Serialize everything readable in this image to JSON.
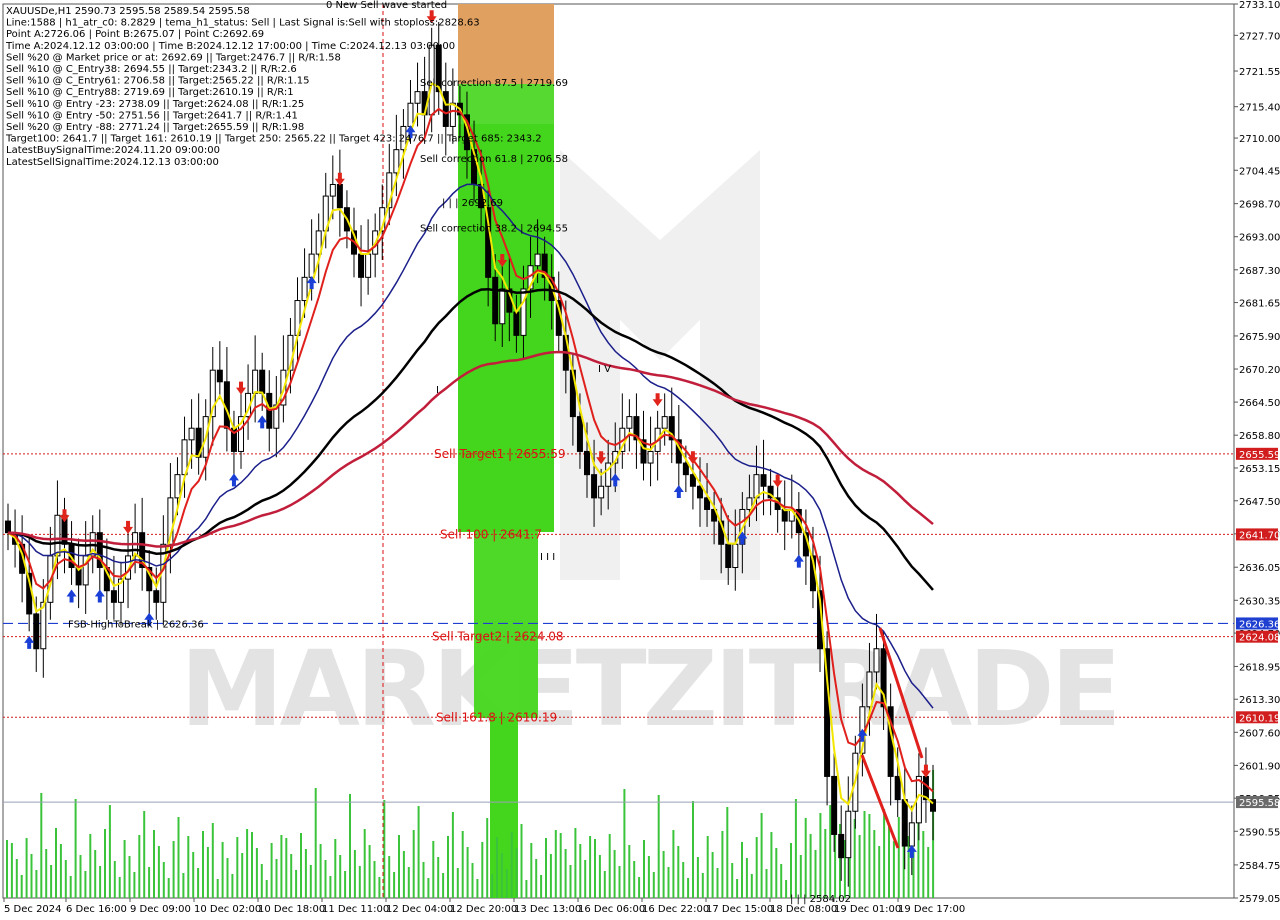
{
  "header": {
    "info_lines": [
      "XAUUSDe,H1  2590.73 2595.58 2589.54 2595.58",
      "Line:1588  |  h1_atr_c0: 8.2829  |  tema_h1_status: Sell  |  Last Signal is:Sell with stoploss:2828.63",
      "Point A:2726.06  |  Point B:2675.07  |  Point C:2692.69",
      "Time A:2024.12.12 03:00:00  |  Time B:2024.12.12 17:00:00  |  Time C:2024.12.13 03:00:00",
      "Sell %20 @ Market price or at: 2692.69  ||  Target:2476.7  ||  R/R:1.58",
      "Sell %10 @ C_Entry38: 2694.55  ||  Target:2343.2  ||  R/R:2.6",
      "Sell %10 @ C_Entry61: 2706.58  ||  Target:2565.22  ||  R/R:1.15",
      "Sell %10 @ C_Entry88: 2719.69  ||  Target:2610.19  ||  R/R:1",
      "Sell %10 @ Entry -23: 2738.09  ||  Target:2624.08  ||  R/R:1.25",
      "Sell %10 @ Entry -50: 2751.56  ||  Target:2641.7  ||  R/R:1.41",
      "Sell %20 @ Entry -88: 2771.24  ||  Target:2655.59  ||  R/R:1.98",
      "Target100: 2641.7  ||  Target 161: 2610.19  ||  Target 250: 2565.22  ||  Target 423: 2476.7  ||  Target 685: 2343.2",
      "LatestBuySignalTime:2024.11.20 09:00:00",
      "LatestSellSignalTime:2024.12.13 03:00:00"
    ],
    "wave_label": "0 New Sell wave started"
  },
  "watermark": "MARKETZITRADE",
  "chart_data": {
    "type": "candlestick",
    "symbol": "XAUUSDe",
    "timeframe": "H1",
    "ylim": [
      2579.05,
      2733.1
    ],
    "y_ticks": [
      2733.1,
      2727.7,
      2721.55,
      2715.4,
      2710.0,
      2704.45,
      2698.7,
      2693.0,
      2687.3,
      2681.65,
      2675.9,
      2670.2,
      2664.5,
      2658.8,
      2653.15,
      2647.5,
      2641.8,
      2636.05,
      2630.35,
      2624.7,
      2618.95,
      2613.3,
      2607.6,
      2601.9,
      2596.25,
      2590.55,
      2584.75,
      2579.05
    ],
    "y_tick_labels": [
      "2733.10",
      "2727.70",
      "2721.55",
      "2715.40",
      "2710.00",
      "2704.45",
      "2698.70",
      "2693.00",
      "2687.30",
      "2681.65",
      "2675.90",
      "2670.20",
      "2664.50",
      "2658.80",
      "2653.15",
      "2647.50",
      "2641.80",
      "2636.05",
      "2630.35",
      "2624.70",
      "2618.95",
      "2613.30",
      "2607.60",
      "2601.90",
      "2596.25",
      "2590.55",
      "2584.75",
      "2579.05"
    ],
    "x_tick_labels": [
      "5 Dec 2024",
      "6 Dec 16:00",
      "9 Dec 09:00",
      "10 Dec 02:00",
      "10 Dec 18:00",
      "11 Dec 11:00",
      "12 Dec 04:00",
      "12 Dec 20:00",
      "13 Dec 13:00",
      "16 Dec 06:00",
      "16 Dec 22:00",
      "17 Dec 15:00",
      "18 Dec 08:00",
      "19 Dec 01:00",
      "19 Dec 17:00"
    ],
    "closes": [
      2642,
      2640,
      2635,
      2628,
      2622,
      2630,
      2638,
      2645,
      2640,
      2636,
      2633,
      2638,
      2642,
      2636,
      2632,
      2630,
      2634,
      2638,
      2642,
      2636,
      2632,
      2630,
      2640,
      2648,
      2652,
      2658,
      2660,
      2655,
      2662,
      2670,
      2668,
      2660,
      2656,
      2662,
      2666,
      2670,
      2666,
      2660,
      2664,
      2670,
      2676,
      2682,
      2686,
      2690,
      2694,
      2700,
      2702,
      2698,
      2694,
      2690,
      2686,
      2690,
      2694,
      2698,
      2704,
      2708,
      2712,
      2716,
      2718,
      2714,
      2726,
      2718,
      2712,
      2716,
      2714,
      2708,
      2702,
      2698,
      2686,
      2678,
      2684,
      2680,
      2676,
      2684,
      2688,
      2690,
      2686,
      2682,
      2676,
      2670,
      2662,
      2656,
      2652,
      2648,
      2650,
      2654,
      2656,
      2660,
      2662,
      2658,
      2654,
      2656,
      2660,
      2662,
      2658,
      2654,
      2652,
      2650,
      2648,
      2646,
      2644,
      2640,
      2636,
      2640,
      2646,
      2648,
      2652,
      2650,
      2648,
      2646,
      2644,
      2646,
      2642,
      2638,
      2632,
      2622,
      2600,
      2590,
      2586,
      2594,
      2604,
      2612,
      2618,
      2622,
      2612,
      2600,
      2596,
      2588,
      2592,
      2600,
      2596,
      2594
    ],
    "current_price": 2595.58,
    "levels": [
      {
        "label": "Sell correction 87.5 | 2719.69",
        "price": 2719.69,
        "style": "text"
      },
      {
        "label": "Sell correction 61.8 | 2706.58",
        "price": 2706.58,
        "style": "text"
      },
      {
        "label": "Sell correction 38.2 | 2694.55",
        "price": 2694.55,
        "style": "text"
      },
      {
        "label": "Sell Target1 | 2655.59",
        "price": 2655.59,
        "style": "red-dotted",
        "tag": "2655.59"
      },
      {
        "label": "Sell 100 | 2641.7",
        "price": 2641.7,
        "style": "red-dotted",
        "tag": "2641.70"
      },
      {
        "label": "FSB-HighToBreak | 2626.36",
        "price": 2626.36,
        "style": "blue-dashed",
        "tag": "2626.36"
      },
      {
        "label": "Sell Target2 | 2624.08",
        "price": 2624.08,
        "style": "red-dotted",
        "tag": "2624.08"
      },
      {
        "label": "Sell 161.8 | 2610.19",
        "price": 2610.19,
        "style": "red-dotted",
        "tag": "2610.19"
      }
    ],
    "annotations": {
      "point_c": "| | | 2692.69",
      "wave_i": "I",
      "wave_iii": "I I I",
      "wave_iv": "I V",
      "bottom": "| | | 2584.02"
    },
    "colors": {
      "buy_arrow": "#1a3fd6",
      "sell_arrow": "#e0241b",
      "zone_top": "#e0a060",
      "zone_main": "#44d61c",
      "ma_black": "#000000",
      "ma_crimson": "#c01e3a",
      "ma_navy": "#1b1f8a",
      "ma_red": "#e0201c",
      "ma_yellow": "#f3e600",
      "volume": "#3bc43b",
      "tag_red": "#d11d1d",
      "tag_blue": "#1f3fd0",
      "tag_grey": "#6b6b6b"
    }
  }
}
